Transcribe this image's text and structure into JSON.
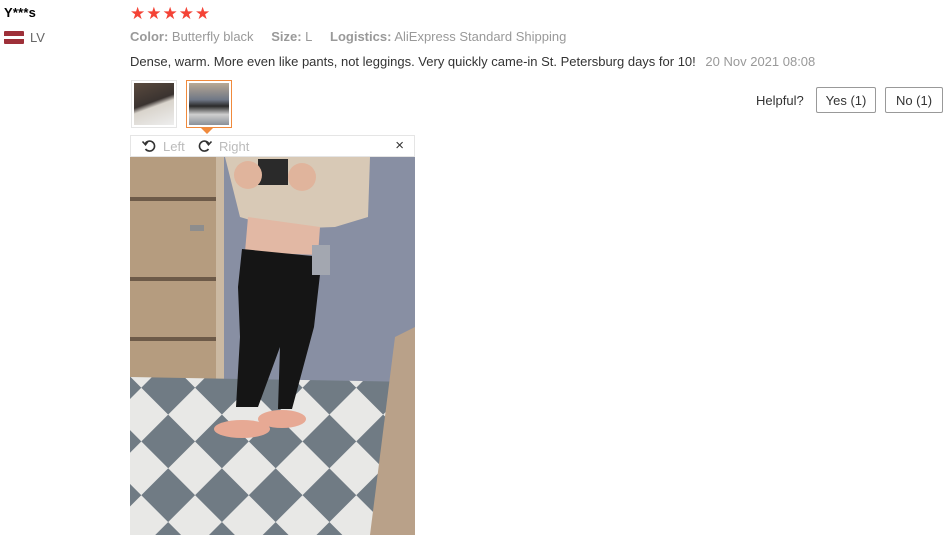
{
  "reviewer": {
    "name": "Y***s",
    "country": "LV"
  },
  "rating": {
    "stars": 5,
    "display": "★★★★★"
  },
  "meta": {
    "color_label": "Color:",
    "color_value": "Butterfly black",
    "size_label": "Size:",
    "size_value": "L",
    "logistics_label": "Logistics:",
    "logistics_value": "AliExpress Standard Shipping"
  },
  "review": {
    "text": "Dense, warm. More even like pants, not leggings. Very quickly came-in St. Petersburg days for 10!",
    "date": "20 Nov 2021 08:08"
  },
  "helpful": {
    "label": "Helpful?",
    "yes": "Yes (1)",
    "no": "No (1)"
  },
  "viewer": {
    "left": "Left",
    "right": "Right",
    "close": "×"
  },
  "colors": {
    "star": "#f44336",
    "active_border": "#f08a3c",
    "flag_red": "#9e3039"
  },
  "icons": [
    "flag-latvia-icon",
    "rotate-left-icon",
    "rotate-right-icon",
    "close-icon"
  ]
}
